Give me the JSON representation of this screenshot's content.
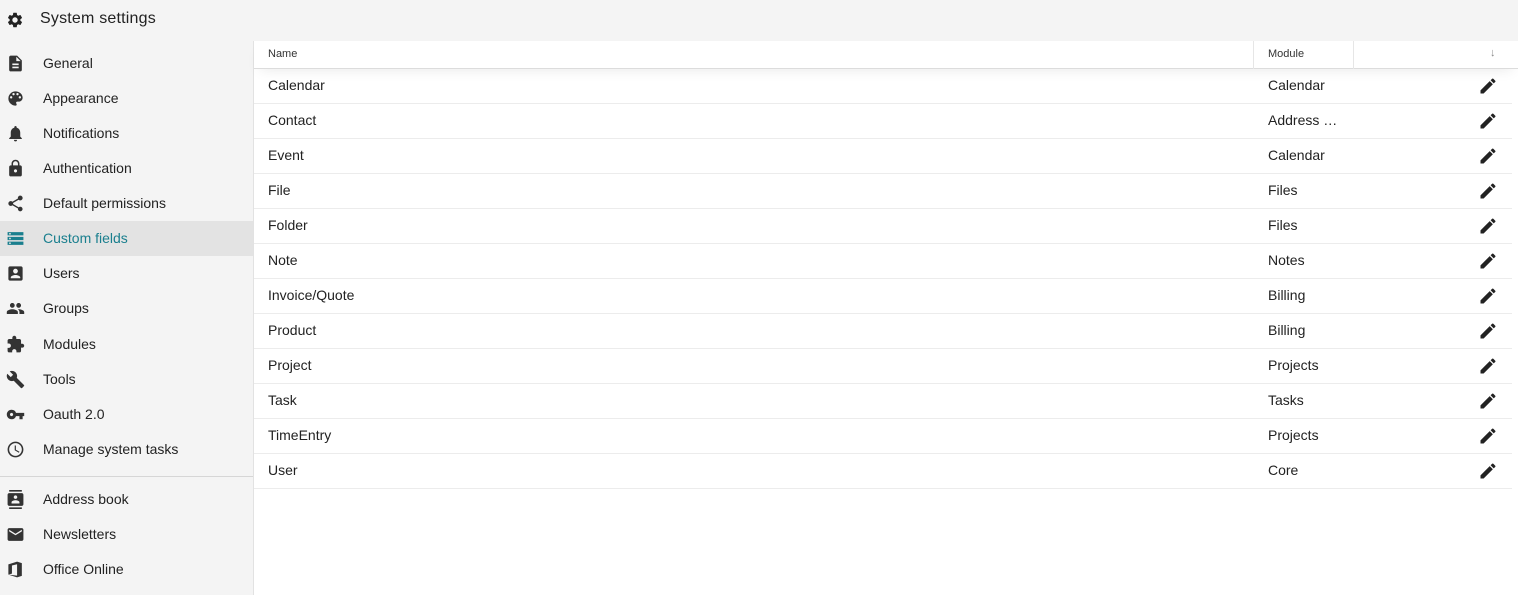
{
  "header": {
    "title": "System settings",
    "icon": "gear-icon"
  },
  "sidebar": {
    "items": [
      {
        "label": "General",
        "icon": "document-icon"
      },
      {
        "label": "Appearance",
        "icon": "palette-icon"
      },
      {
        "label": "Notifications",
        "icon": "bell-icon"
      },
      {
        "label": "Authentication",
        "icon": "lock-icon"
      },
      {
        "label": "Default permissions",
        "icon": "share-icon"
      },
      {
        "label": "Custom fields",
        "icon": "storage-list-icon",
        "active": true
      },
      {
        "label": "Users",
        "icon": "account-box-icon"
      },
      {
        "label": "Groups",
        "icon": "people-icon"
      },
      {
        "label": "Modules",
        "icon": "puzzle-icon"
      },
      {
        "label": "Tools",
        "icon": "wrench-icon"
      },
      {
        "label": "Oauth 2.0",
        "icon": "key-icon"
      },
      {
        "label": "Manage system tasks",
        "icon": "clock-icon"
      }
    ],
    "module_items": [
      {
        "label": "Address book",
        "icon": "contacts-icon"
      },
      {
        "label": "Newsletters",
        "icon": "mail-icon"
      },
      {
        "label": "Office Online",
        "icon": "office-icon"
      }
    ]
  },
  "table": {
    "columns": {
      "name": "Name",
      "module": "Module",
      "sort": "↓"
    },
    "rows": [
      {
        "name": "Calendar",
        "module": "Calendar"
      },
      {
        "name": "Contact",
        "module": "Address book"
      },
      {
        "name": "Event",
        "module": "Calendar"
      },
      {
        "name": "File",
        "module": "Files"
      },
      {
        "name": "Folder",
        "module": "Files"
      },
      {
        "name": "Note",
        "module": "Notes"
      },
      {
        "name": "Invoice/Quote",
        "module": "Billing"
      },
      {
        "name": "Product",
        "module": "Billing"
      },
      {
        "name": "Project",
        "module": "Projects"
      },
      {
        "name": "Task",
        "module": "Tasks"
      },
      {
        "name": "TimeEntry",
        "module": "Projects"
      },
      {
        "name": "User",
        "module": "Core"
      }
    ]
  },
  "colors": {
    "accent": "#1a7f8e",
    "icon": "#333333",
    "active_bg": "#e3e3e3"
  }
}
